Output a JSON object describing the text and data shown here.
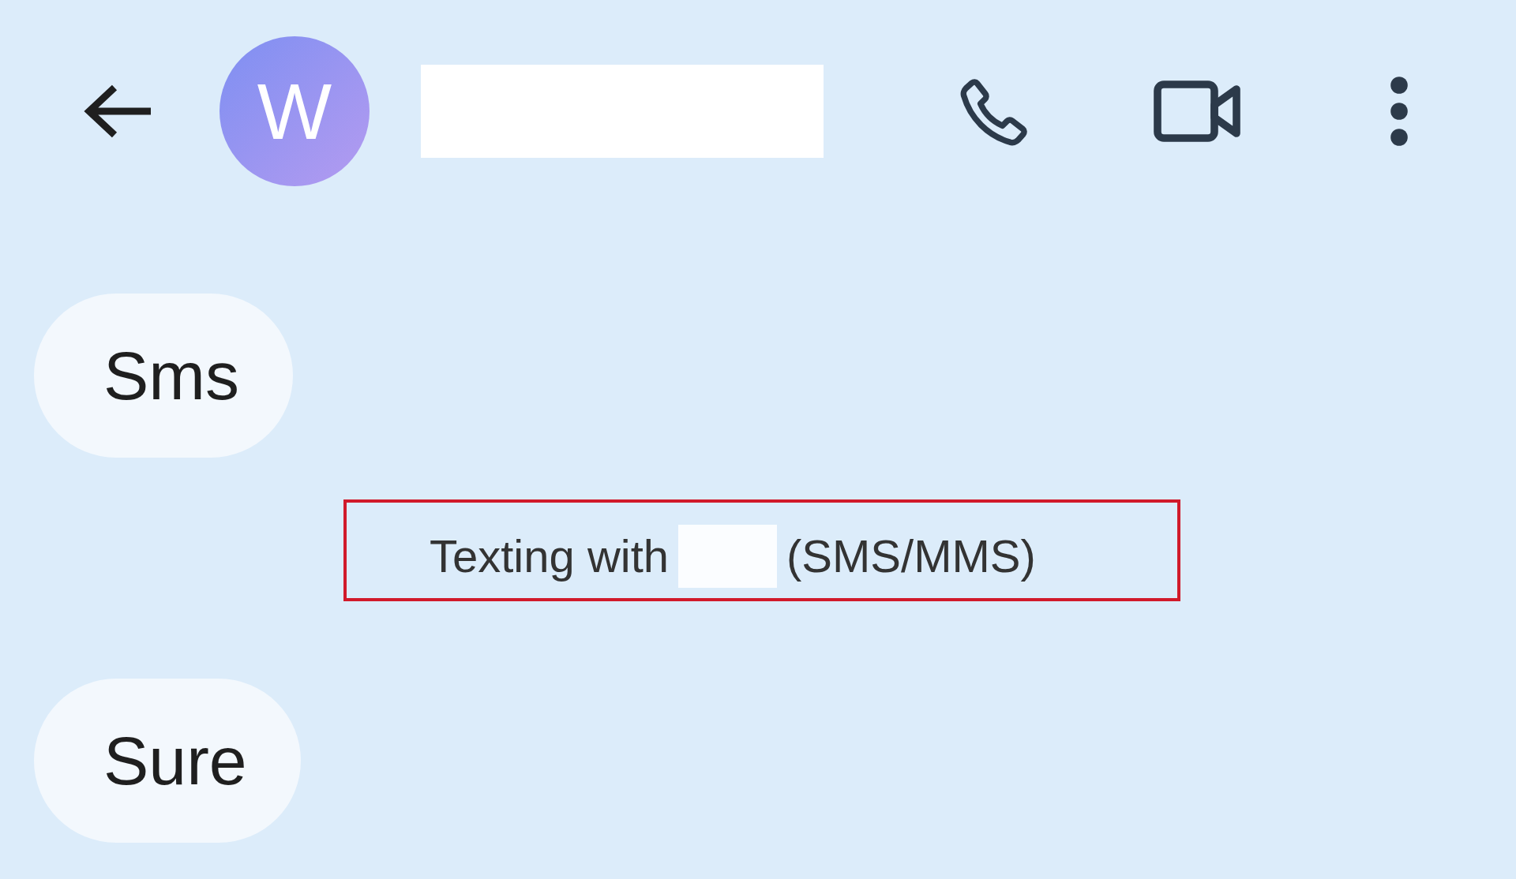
{
  "header": {
    "avatar_initial": "W"
  },
  "messages": [
    {
      "kind": "incoming",
      "text": "Sms"
    },
    {
      "kind": "status",
      "prefix": "Texting with",
      "suffix": "(SMS/MMS)",
      "highlighted": true
    },
    {
      "kind": "incoming",
      "text": "Sure"
    }
  ]
}
